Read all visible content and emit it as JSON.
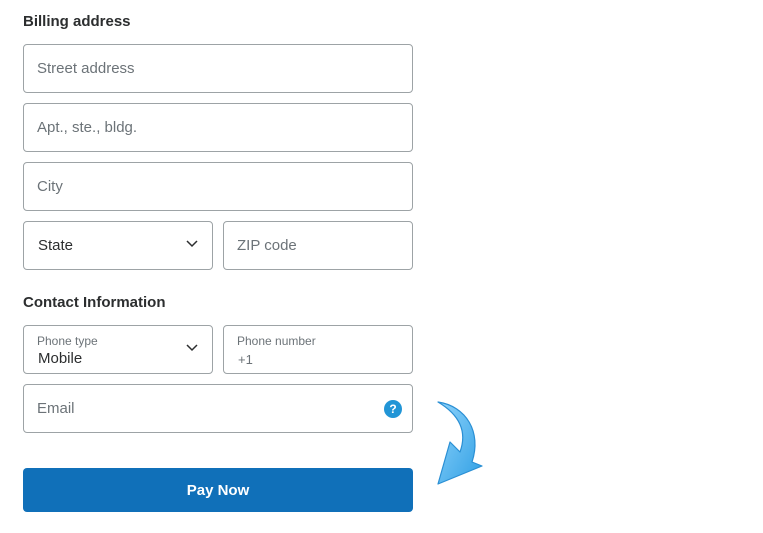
{
  "billing": {
    "heading": "Billing address",
    "street_placeholder": "Street address",
    "apt_placeholder": "Apt., ste., bldg.",
    "city_placeholder": "City",
    "state_value": "State",
    "zip_placeholder": "ZIP code"
  },
  "contact": {
    "heading": "Contact Information",
    "phone_type_label": "Phone type",
    "phone_type_value": "Mobile",
    "phone_number_label": "Phone number",
    "phone_number_prefix": "+1",
    "email_placeholder": "Email",
    "help_glyph": "?"
  },
  "actions": {
    "pay_label": "Pay Now"
  },
  "icons": {
    "chevron": "chevron-down-icon",
    "help": "help-icon",
    "arrow": "curved-arrow-icon"
  },
  "colors": {
    "button": "#1070b9",
    "help_icon": "#2195d6",
    "arrow": "#4db3ee"
  }
}
